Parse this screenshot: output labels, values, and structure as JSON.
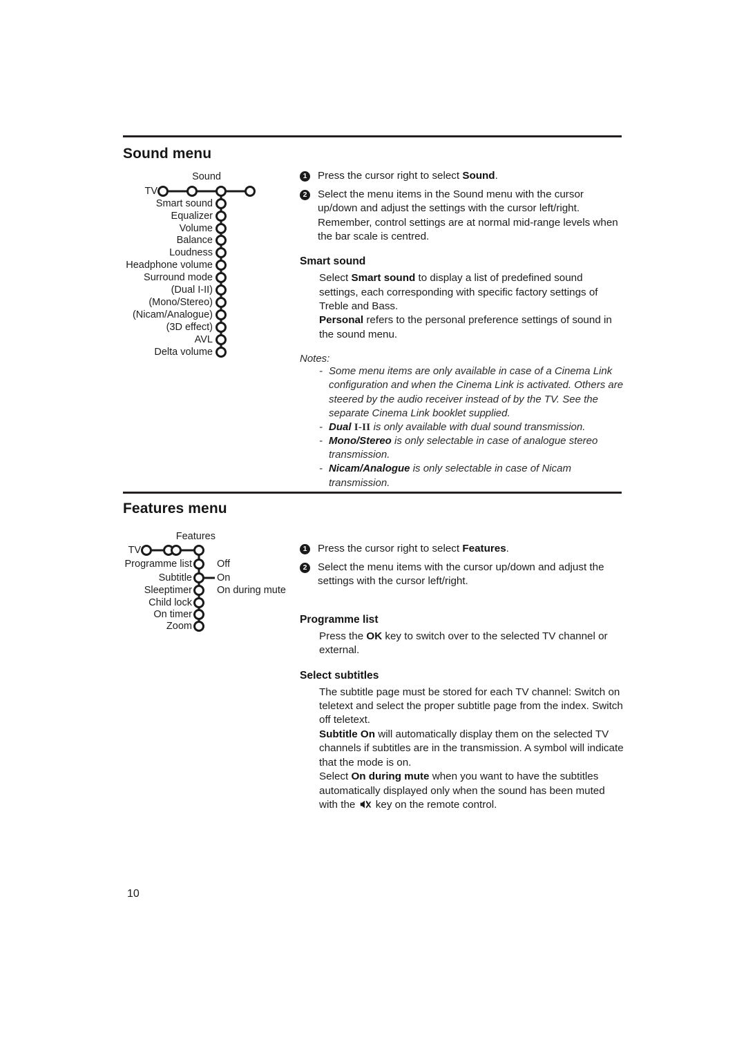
{
  "document": {
    "page_number": "10",
    "ink_color": "#1a1a1a",
    "background_color": "#ffffff"
  },
  "sections": [
    {
      "id": "sound",
      "title": "Sound menu",
      "diagram": {
        "root_label": "TV",
        "branch_label": "Sound",
        "items": [
          "Smart sound",
          "Equalizer",
          "Volume",
          "Balance",
          "Loudness",
          "Headphone volume",
          "Surround mode",
          "(Dual I-II)",
          "(Mono/Stereo)",
          "(Nicam/Analogue)",
          "(3D effect)",
          "AVL",
          "Delta volume"
        ],
        "options": []
      },
      "steps": [
        {
          "num": "1",
          "html": "Press the cursor right to select <b>Sound</b>."
        },
        {
          "num": "2",
          "html": "Select the menu items in the Sound menu with the cursor up/down and adjust the settings with the cursor left/right. Remember, control settings are at normal mid-range levels when the bar scale is centred."
        }
      ],
      "subsections": [
        {
          "heading": "Smart sound",
          "paragraphs": [
            "Select <b>Smart sound</b> to display a list of predefined sound settings, each corresponding with specific factory settings of Treble and Bass.",
            "<b>Personal</b> refers to the personal preference settings of sound in the sound menu."
          ]
        }
      ],
      "notes": {
        "label": "Notes:",
        "items": [
          "Some menu items are only available in case of a Cinema Link configuration and when the Cinema Link is activated. Others are steered by the audio receiver instead of by the TV. See the separate Cinema Link booklet supplied.",
          "<b>Dual</b> <span class=\"roman\">I-II</span> is only available with dual sound transmission.",
          "<b>Mono/Stereo</b> is only selectable in case of analogue stereo transmission.",
          "<b>Nicam/Analogue</b> is only selectable in case of Nicam transmission."
        ]
      }
    },
    {
      "id": "features",
      "title": "Features menu",
      "diagram": {
        "root_label": "TV",
        "branch_label": "Features",
        "items": [
          "Programme list",
          "Subtitle",
          "Sleeptimer",
          "Child lock",
          "On timer",
          "Zoom"
        ],
        "options": [
          "Off",
          "On",
          "On during mute"
        ]
      },
      "steps": [
        {
          "num": "1",
          "html": "Press the cursor right to select <b>Features</b>."
        },
        {
          "num": "2",
          "html": "Select the menu items with the cursor up/down and adjust the settings with the cursor left/right."
        }
      ],
      "subsections": [
        {
          "heading": "Programme list",
          "paragraphs": [
            "Press the <b>OK</b> key to switch over to the selected TV channel or external."
          ]
        },
        {
          "heading": "Select subtitles",
          "paragraphs": [
            "The subtitle page must be stored for each TV channel: Switch on teletext and select the proper subtitle page from the index. Switch off teletext.",
            "<b>Subtitle On</b> will automatically display them on the selected TV channels if subtitles are in the transmission. A symbol will indicate that the mode is on.",
            "Select <b>On during mute</b> when you want to have the subtitles automatically displayed only when the sound has been muted with the <span class=\"mute-slot\"></span> key on the remote control."
          ]
        }
      ],
      "notes": null
    }
  ],
  "icons": {
    "mute": "mute-speaker-icon",
    "step_marker": "filled-circle-number"
  }
}
